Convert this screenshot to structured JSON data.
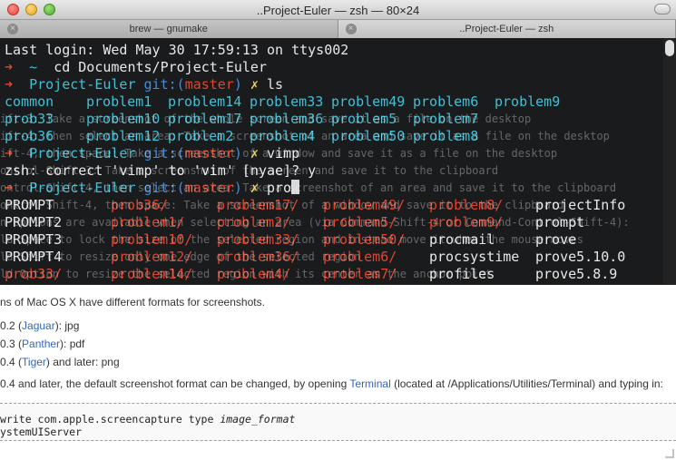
{
  "window": {
    "title": "..Project-Euler — zsh — 80×24"
  },
  "tabs": [
    {
      "label": "brew — gnumake",
      "active": false
    },
    {
      "label": "..Project-Euler — zsh",
      "active": true
    }
  ],
  "terminal": {
    "last_login": "Last login: Wed May 30 17:59:13 on ttys002",
    "prompt_arrow": "➜",
    "home_prompt": "~",
    "cmd_cd": "cd Documents/Project-Euler",
    "cwd": "Project-Euler",
    "git_label": "git:(",
    "branch": "master",
    "git_close": ")",
    "dirty_mark": "✗",
    "cmd_ls": "ls",
    "ls_rows": [
      [
        "common",
        "problem1",
        "problem14",
        "problem33",
        "problem49",
        "problem6",
        "problem9"
      ],
      [
        "prob33",
        "problem10",
        "problem17",
        "problem36",
        "problem5",
        "problem7",
        ""
      ],
      [
        "prob36",
        "problem12",
        "problem2",
        "problem4",
        "problem50",
        "problem8",
        ""
      ]
    ],
    "cmd_vimp": "vimp",
    "correction": "zsh: correct 'vimp' to 'vim' [nyae]? y",
    "cmd_pro": "pro",
    "completion_rows": [
      [
        "PROMPT",
        "prob36/",
        "problem17/",
        "problem49/",
        "problem8/",
        "projectInfo"
      ],
      [
        "PROMPT2",
        "problem1/",
        "problem2/",
        "problem5/",
        "problem9/",
        "prompt"
      ],
      [
        "PROMPT3",
        "problem10/",
        "problem33/",
        "problem50/",
        "procmail",
        "prove"
      ],
      [
        "PROMPT4",
        "problem12/",
        "problem36/",
        "problem6/",
        "procsystime",
        "prove5.10.0"
      ],
      [
        "prob33/",
        "problem14/",
        "problem4/",
        "problem7/",
        "profiles",
        "prove5.8.9"
      ]
    ]
  },
  "background_ghost": [
    "ift-3: Take a screenshot of the whole screen and save it as a file on the desktop",
    "ift-4: then select an area: Take a screenshot of an area and save it as a file on the desktop",
    "ift-4, then space: Take a screenshot of a window and save it as a file on the desktop",
    "ontrol-Shift-3: Take a screenshot of the screen and save it to the clipboard",
    "ontrol-Shift-4, then select an area: Take a screenshot of an area and save it to the clipboard",
    "ontrol-Shift-4, then space: Take a screenshot of a window and save it to the clipboard",
    "n options are available when selecting an area (via Command-Shift-4 or Command-Control-Shift-4):",
    "ld Space to lock the size of the selected region and instead move it when the mouse moves",
    "ld Shift to resize only one edge of the selected region",
    "ld Option to resize the selected region with its center as the anchor point"
  ],
  "page": {
    "intro": "ns of Mac OS X have different formats for screenshots.",
    "v1_pre": "0.2 (",
    "v1_link": "Jaguar",
    "v1_post": "): jpg",
    "v2_pre": "0.3 (",
    "v2_link": "Panther",
    "v2_post": "): pdf",
    "v3_pre": "0.4 (",
    "v3_link": "Tiger",
    "v3_post": ") and later: png",
    "later_pre": "0.4 and later, the default screenshot format can be changed, by opening ",
    "later_link": "Terminal",
    "later_post": " (located at /Applications/Utilities/Terminal) and typing in:",
    "code_line1_pre": "write com.apple.screencapture type ",
    "code_line1_em": "image_format",
    "code_line2": "ystemUIServer"
  }
}
